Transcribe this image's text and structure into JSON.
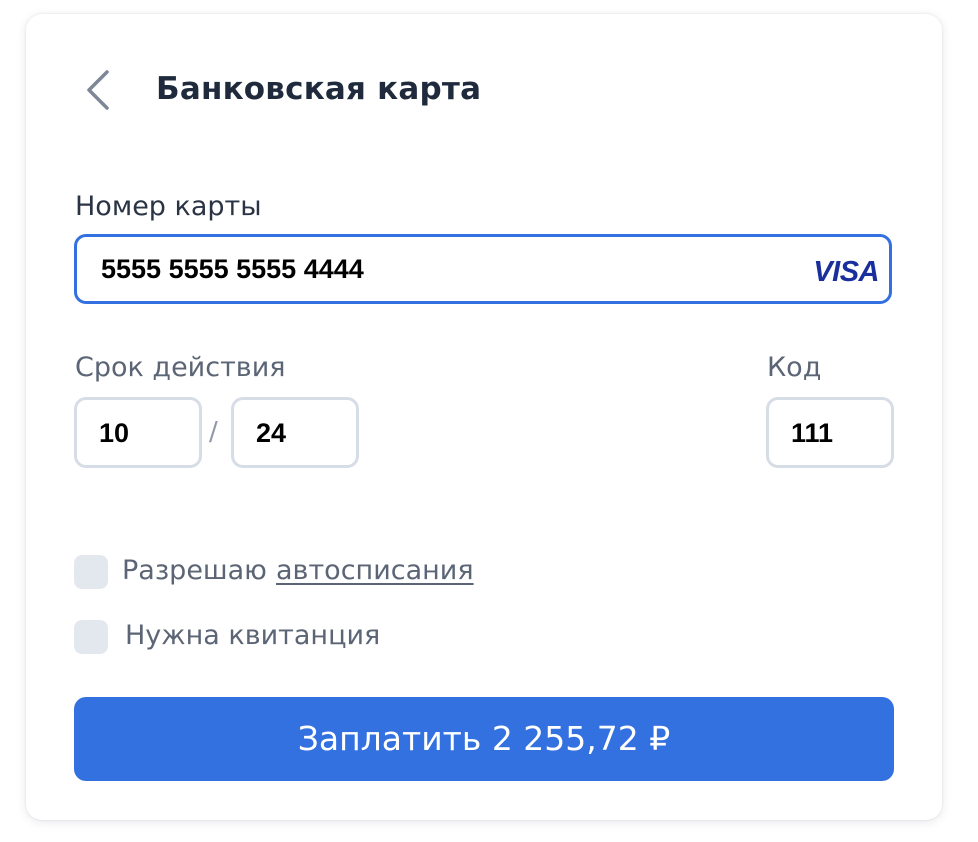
{
  "header": {
    "back_icon": "chevron-left-icon",
    "title": "Банковская карта"
  },
  "card_number": {
    "label": "Номер карты",
    "value": "5555 5555 5555 4444",
    "brand": "VISA"
  },
  "expiry": {
    "label": "Срок действия",
    "month": "10",
    "separator": "/",
    "year": "24"
  },
  "cvc": {
    "label": "Код",
    "value": "111"
  },
  "options": {
    "autopay_text": "Разрешаю",
    "autopay_link": "автосписания",
    "autopay_checked": false,
    "receipt_text": "Нужна квитанция",
    "receipt_checked": false
  },
  "pay_button": {
    "label": "Заплатить 2 255,72 ₽"
  },
  "colors": {
    "accent": "#3370e0",
    "visa": "#1a2f9e",
    "checkbox_bg": "#e3e8ef",
    "input_border": "#d7dde6"
  }
}
